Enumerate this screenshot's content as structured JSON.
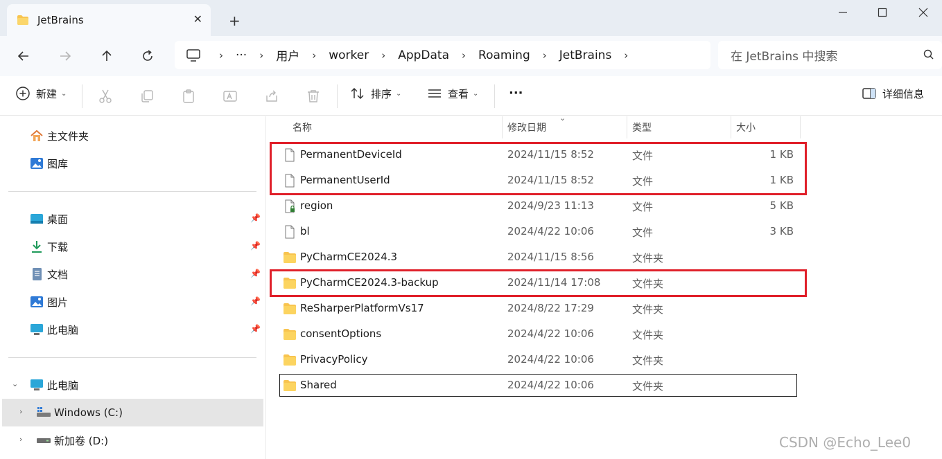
{
  "tab": {
    "title": "JetBrains"
  },
  "breadcrumbs": [
    "用户",
    "worker",
    "AppData",
    "Roaming",
    "JetBrains"
  ],
  "search": {
    "placeholder": "在 JetBrains 中搜索"
  },
  "toolbar": {
    "new_label": "新建",
    "sort_label": "排序",
    "view_label": "查看",
    "more_label": "···",
    "details_label": "详细信息"
  },
  "sidebar": {
    "home": "主文件夹",
    "gallery": "图库",
    "quick": [
      "桌面",
      "下载",
      "文档",
      "图片",
      "此电脑"
    ],
    "this_pc": "此电脑",
    "drives": [
      "Windows (C:)",
      "新加卷 (D:)"
    ]
  },
  "columns": {
    "name": "名称",
    "date": "修改日期",
    "type": "类型",
    "size": "大小"
  },
  "files": [
    {
      "name": "PermanentDeviceId",
      "date": "2024/11/15 8:52",
      "type": "文件",
      "size": "1 KB",
      "icon": "file-icon"
    },
    {
      "name": "PermanentUserId",
      "date": "2024/11/15 8:52",
      "type": "文件",
      "size": "1 KB",
      "icon": "file-icon"
    },
    {
      "name": "region",
      "date": "2024/9/23 11:13",
      "type": "文件",
      "size": "5 KB",
      "icon": "locked-file-icon"
    },
    {
      "name": "bl",
      "date": "2024/4/22 10:06",
      "type": "文件",
      "size": "3 KB",
      "icon": "file-icon"
    },
    {
      "name": "PyCharmCE2024.3",
      "date": "2024/11/15 8:56",
      "type": "文件夹",
      "size": "",
      "icon": "folder-icon"
    },
    {
      "name": "PyCharmCE2024.3-backup",
      "date": "2024/11/14 17:08",
      "type": "文件夹",
      "size": "",
      "icon": "folder-icon"
    },
    {
      "name": "ReSharperPlatformVs17",
      "date": "2024/8/22 17:29",
      "type": "文件夹",
      "size": "",
      "icon": "folder-icon"
    },
    {
      "name": "consentOptions",
      "date": "2024/4/22 10:06",
      "type": "文件夹",
      "size": "",
      "icon": "folder-icon"
    },
    {
      "name": "PrivacyPolicy",
      "date": "2024/4/22 10:06",
      "type": "文件夹",
      "size": "",
      "icon": "folder-icon"
    },
    {
      "name": "Shared",
      "date": "2024/4/22 10:06",
      "type": "文件夹",
      "size": "",
      "icon": "folder-icon"
    }
  ],
  "watermark": "CSDN @Echo_Lee0",
  "colors": {
    "highlight_box": "#e0202a",
    "folder": "#f8c44f",
    "selected_row": "#e5e5e5"
  }
}
